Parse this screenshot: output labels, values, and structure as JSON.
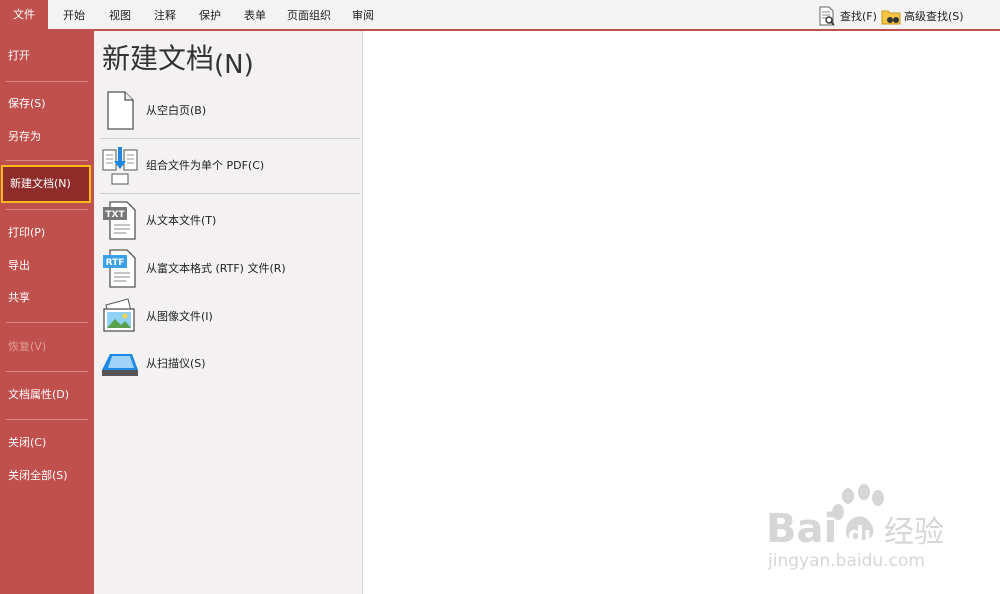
{
  "ribbon": {
    "tabs": [
      "文件",
      "开始",
      "视图",
      "注释",
      "保护",
      "表单",
      "页面组织",
      "审阅"
    ],
    "find_label": "查找(F)",
    "advanced_find_label": "高级查找(S)"
  },
  "nav": {
    "open": "打开",
    "save": "保存(S)",
    "save_as": "另存为",
    "new_document": "新建文档(N)",
    "print": "打印(P)",
    "export": "导出",
    "share": "共享",
    "restore": "恢复(V)",
    "properties": "文档属性(D)",
    "close": "关闭(C)",
    "close_all": "关闭全部(S)"
  },
  "panel": {
    "title": "新建文档",
    "title_suffix": "(N)",
    "options": {
      "blank": "从空白页(B)",
      "combine": "组合文件为单个 PDF(C)",
      "text_file": "从文本文件(T)",
      "rtf_file": "从富文本格式 (RTF) 文件(R)",
      "image_file": "从图像文件(I)",
      "scanner": "从扫描仪(S)"
    },
    "icon_text": {
      "txt": "TXT",
      "rtf": "RTF"
    }
  },
  "watermark": {
    "brand": "Bai",
    "brand2": "du",
    "cn": "经验",
    "url": "jingyan.baidu.com"
  },
  "colors": {
    "accent": "#c0504d",
    "active": "#8e2c2a",
    "highlight": "#ffb81c"
  }
}
